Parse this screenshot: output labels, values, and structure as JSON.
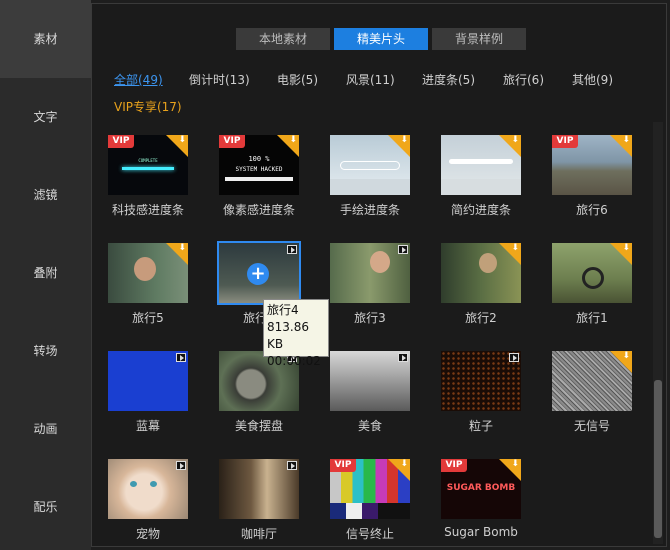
{
  "sidebar": {
    "items": [
      {
        "label": "素材",
        "active": true
      },
      {
        "label": "文字"
      },
      {
        "label": "滤镜"
      },
      {
        "label": "叠附"
      },
      {
        "label": "转场"
      },
      {
        "label": "动画"
      },
      {
        "label": "配乐"
      }
    ]
  },
  "tabs": [
    {
      "label": "本地素材"
    },
    {
      "label": "精美片头",
      "active": true
    },
    {
      "label": "背景样例"
    }
  ],
  "filters": [
    {
      "label": "全部(49)",
      "active": true
    },
    {
      "label": "倒计时(13)"
    },
    {
      "label": "电影(5)"
    },
    {
      "label": "风景(11)"
    },
    {
      "label": "进度条(5)"
    },
    {
      "label": "旅行(6)"
    },
    {
      "label": "其他(9)"
    },
    {
      "label": "VIP专享(17)",
      "vip": true
    }
  ],
  "items": [
    {
      "label": "科技感进度条",
      "vip": true,
      "download": true
    },
    {
      "label": "像素感进度条",
      "vip": true,
      "download": true
    },
    {
      "label": "手绘进度条",
      "download": true
    },
    {
      "label": "简约进度条",
      "download": true
    },
    {
      "label": "旅行6",
      "vip": true,
      "download": true
    },
    {
      "label": "旅行5",
      "download": true
    },
    {
      "label": "旅行4",
      "selected": true
    },
    {
      "label": "旅行3"
    },
    {
      "label": "旅行2",
      "download": true
    },
    {
      "label": "旅行1",
      "download": true
    },
    {
      "label": "蓝幕"
    },
    {
      "label": "美食摆盘"
    },
    {
      "label": "美食"
    },
    {
      "label": "粒子"
    },
    {
      "label": "无信号",
      "download": true
    },
    {
      "label": "宠物"
    },
    {
      "label": "咖啡厅"
    },
    {
      "label": "信号终止",
      "vip": true,
      "download": true
    },
    {
      "label": "Sugar Bomb",
      "vip": true,
      "download": true
    }
  ],
  "thumb_text": {
    "progress1": "COMPLETE",
    "pixel1": "100 %",
    "pixel2": "SYSTEM HACKED",
    "sugar": "SUGAR BOMB",
    "vip": "VIP",
    "download_icon": "⬇"
  },
  "tooltip": {
    "name": "旅行4",
    "size": "813.86 KB",
    "duration": "00:00:02"
  },
  "colors": {
    "accent": "#1d7fe0",
    "vip": "#e33a3a",
    "vip_text": "#e8a21c",
    "download": "#f0a71a"
  }
}
